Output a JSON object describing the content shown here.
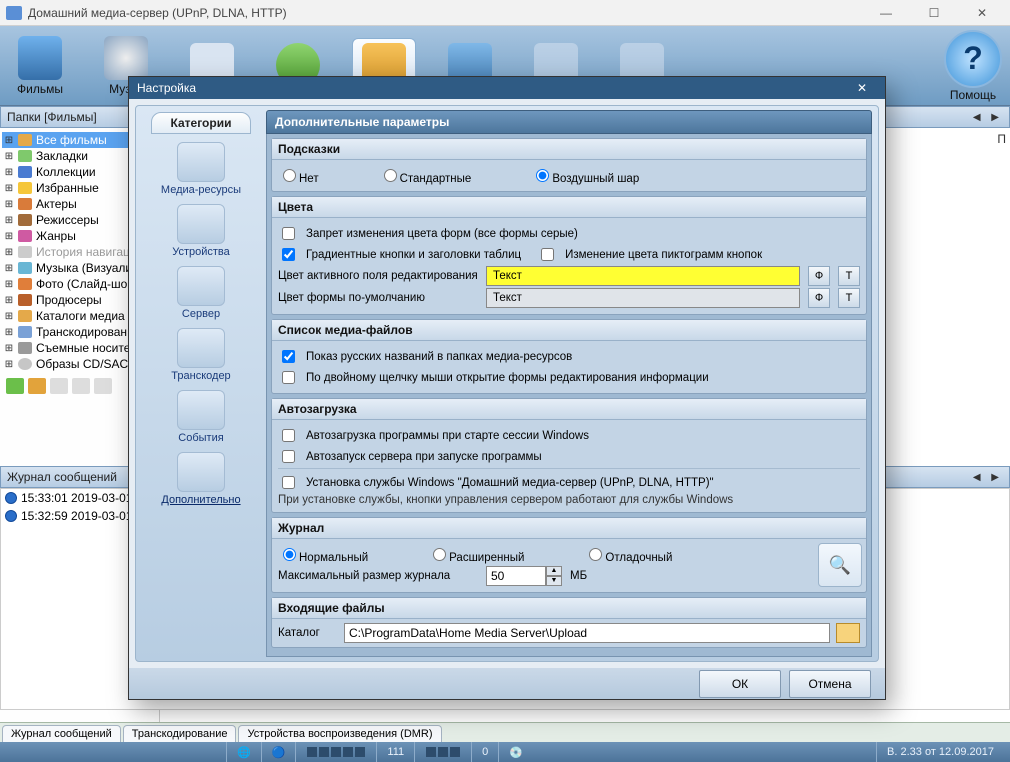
{
  "window": {
    "title": "Домашний медиа-сервер (UPnP, DLNA, HTTP)",
    "min": "—",
    "max": "☐",
    "close": "✕"
  },
  "toolbar": {
    "films": "Фильмы",
    "music": "Муз…",
    "help": "Помощь"
  },
  "folders_header": "Папки [Фильмы]",
  "tree": {
    "items": [
      "Все фильмы",
      "Закладки",
      "Коллекции",
      "Избранные",
      "Актеры",
      "Режиссеры",
      "Жанры",
      "История навигац",
      "Музыка (Визуали",
      "Фото (Слайд-шо",
      "Продюсеры",
      "Каталоги медиа",
      "Транскодирован",
      "Съемные носите",
      "Образы CD/SACD"
    ]
  },
  "log_header": "Журнал сообщений",
  "log_rows": [
    "15:33:01 2019-03-01",
    "15:32:59 2019-03-01"
  ],
  "bottom_tabs": [
    "Журнал сообщений",
    "Транскодирование",
    "Устройства воспроизведения (DMR)"
  ],
  "status": {
    "num": "111",
    "zero": "0",
    "version": "В. 2.33 от 12.09.2017"
  },
  "modal": {
    "title": "Настройка",
    "categories_tab": "Категории",
    "categories": [
      "Медиа-ресурсы",
      "Устройства",
      "Сервер",
      "Транскодер",
      "События",
      "Дополнительно"
    ],
    "section_title": "Дополнительные параметры",
    "hints": {
      "title": "Подсказки",
      "opts": [
        "Нет",
        "Стандартные",
        "Воздушный шар"
      ],
      "selected": 2
    },
    "colors": {
      "title": "Цвета",
      "forbid": "Запрет изменения цвета форм (все формы серые)",
      "gradient": "Градиентные кнопки и заголовки таблиц",
      "iconcolor": "Изменение цвета пиктограмм кнопок",
      "active_label": "Цвет активного поля редактирования",
      "default_label": "Цвет формы по-умолчанию",
      "text": "Текст",
      "ph": "Ф",
      "t": "Т"
    },
    "mediafiles": {
      "title": "Список медиа-файлов",
      "opt1": "Показ русских названий в папках медиа-ресурсов",
      "opt2": "По двойному щелчку мыши открытие формы редактирования информации"
    },
    "autostart": {
      "title": "Автозагрузка",
      "opt1": "Автозагрузка программы при старте сессии Windows",
      "opt2": "Автозапуск сервера при запуске программы",
      "opt3": "Установка службы Windows \"Домашний медиа-сервер (UPnP, DLNA, HTTP)\"",
      "note": "При установке службы, кнопки управления сервером работают для службы Windows"
    },
    "journal": {
      "title": "Журнал",
      "opts": [
        "Нормальный",
        "Расширенный",
        "Отладочный"
      ],
      "sizelabel": "Максимальный размер журнала",
      "size": "50",
      "mb": "МБ"
    },
    "incoming": {
      "title": "Входящие файлы",
      "label": "Каталог",
      "path": "C:\\ProgramData\\Home Media Server\\Upload"
    },
    "ok": "ОК",
    "cancel": "Отмена"
  },
  "right_col_hint": "П"
}
